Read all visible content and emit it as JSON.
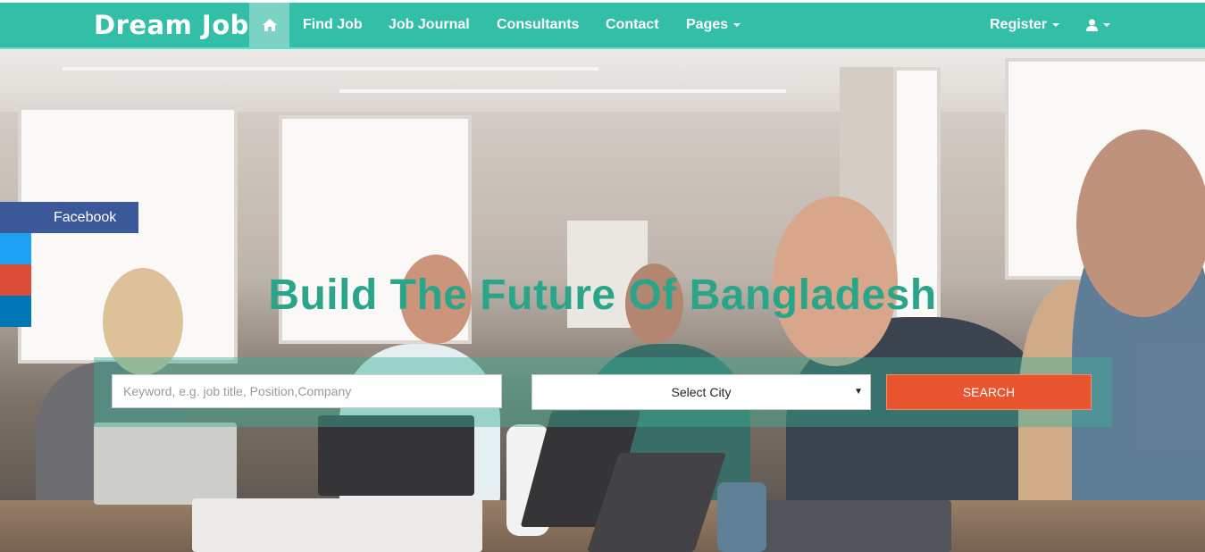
{
  "brand": "Dream Job",
  "nav": {
    "home_icon": "home-icon",
    "items": [
      "Find Job",
      "Job Journal",
      "Consultants",
      "Contact",
      "Pages"
    ],
    "register": "Register",
    "user_icon": "user-icon"
  },
  "hero": {
    "title": "Build The Future Of Bangladesh",
    "keyword_placeholder": "Keyword, e.g. job title, Position,Company",
    "city_selected": "Select City",
    "search_label": "SEARCH"
  },
  "social": {
    "facebook": "Facebook",
    "twitter_icon": "twitter-icon",
    "google_icon": "google-plus-icon",
    "linkedin_icon": "linkedin-icon"
  },
  "colors": {
    "primary": "#33bea7",
    "title": "#2aa58a",
    "search_button": "#e8552f",
    "facebook": "#3b5998",
    "twitter": "#1da1f2",
    "google": "#dd4b39",
    "linkedin": "#0077b5"
  }
}
